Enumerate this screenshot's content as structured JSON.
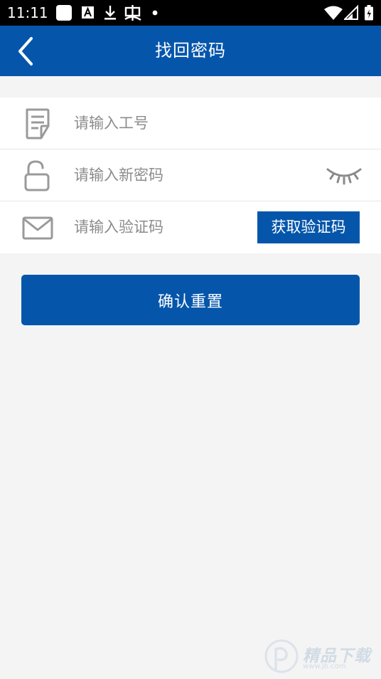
{
  "status_bar": {
    "time": "11:11",
    "icons": [
      "app-square-icon",
      "font-a-icon",
      "download-icon",
      "bug-icon",
      "dot-icon",
      "wifi-icon",
      "signal-icon",
      "battery-icon"
    ]
  },
  "header": {
    "title": "找回密码",
    "back_icon": "chevron-left-icon"
  },
  "form": {
    "employee_id": {
      "icon": "document-icon",
      "value": "",
      "placeholder": "请输入工号"
    },
    "new_password": {
      "icon": "unlock-icon",
      "value": "",
      "placeholder": "请输入新密码",
      "toggle_icon": "eye-closed-icon"
    },
    "verification_code": {
      "icon": "envelope-icon",
      "value": "",
      "placeholder": "请输入验证码",
      "get_code_label": "获取验证码"
    }
  },
  "actions": {
    "confirm_label": "确认重置"
  },
  "watermark": {
    "text": "精品下载",
    "url": "www.jb.com"
  },
  "colors": {
    "primary": "#0556ab",
    "background": "#f4f4f4",
    "card": "#ffffff",
    "placeholder": "#8c8c8c",
    "icon_gray": "#9a9a9a"
  }
}
